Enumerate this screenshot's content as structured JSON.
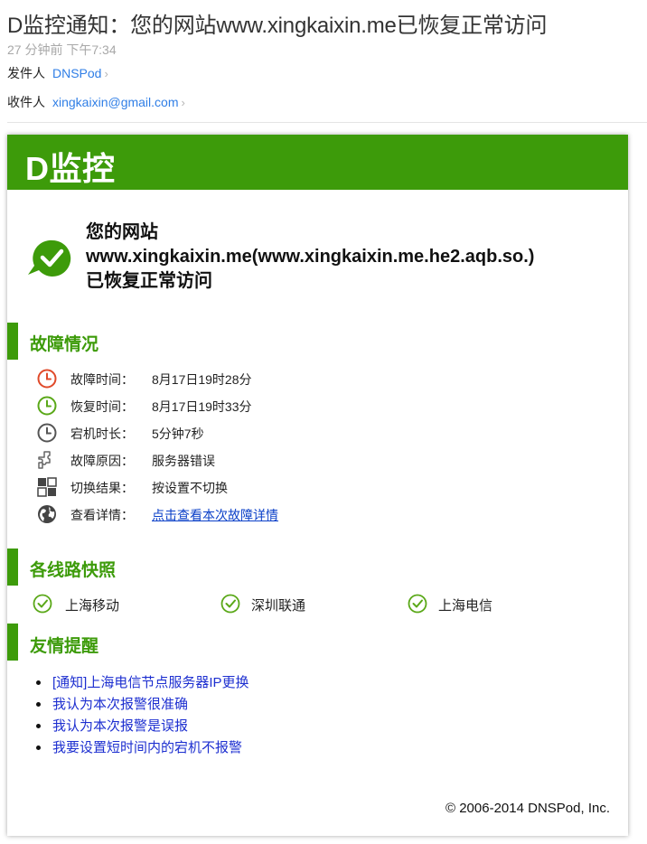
{
  "mail": {
    "subject": "D监控通知：您的网站www.xingkaixin.me已恢复正常访问",
    "timestamp": "27 分钟前 下午7:34",
    "from_label": "发件人",
    "from_value": "DNSPod",
    "to_label": "收件人",
    "to_value": "xingkaixin@gmail.com"
  },
  "card": {
    "brand": "D监控",
    "status_lines": [
      "您的网站",
      "www.xingkaixin.me(www.xingkaixin.me.he2.aqb.so.)",
      "已恢复正常访问"
    ],
    "fault_section": {
      "title": "故障情况",
      "rows": [
        {
          "icon": "clock-red-icon",
          "label": "故障时间：",
          "value": "8月17日19时28分"
        },
        {
          "icon": "clock-green-icon",
          "label": "恢复时间：",
          "value": "8月17日19时33分"
        },
        {
          "icon": "clock-gray-icon",
          "label": "宕机时长：",
          "value": "5分钟7秒"
        },
        {
          "icon": "puzzle-icon",
          "label": "故障原因：",
          "value": "服务器错误"
        },
        {
          "icon": "grid-icon",
          "label": "切换结果：",
          "value": "按设置不切换"
        },
        {
          "icon": "globe-icon",
          "label": "查看详情：",
          "value": "点击查看本次故障详情"
        }
      ]
    },
    "lines_section": {
      "title": "各线路快照",
      "items": [
        "上海移动",
        "深圳联通",
        "上海电信"
      ]
    },
    "tips_section": {
      "title": "友情提醒",
      "items": [
        "[通知]上海电信节点服务器IP更换",
        "我认为本次报警很准确",
        "我认为本次报警是误报",
        "我要设置短时间内的宕机不报警"
      ]
    },
    "copyright": "© 2006-2014 DNSPod, Inc."
  },
  "colors": {
    "brand_green": "#3d9b0a",
    "link_blue": "#2f7ee6",
    "tip_blue": "#1d2fd0",
    "alert_red": "#e04a2a"
  }
}
